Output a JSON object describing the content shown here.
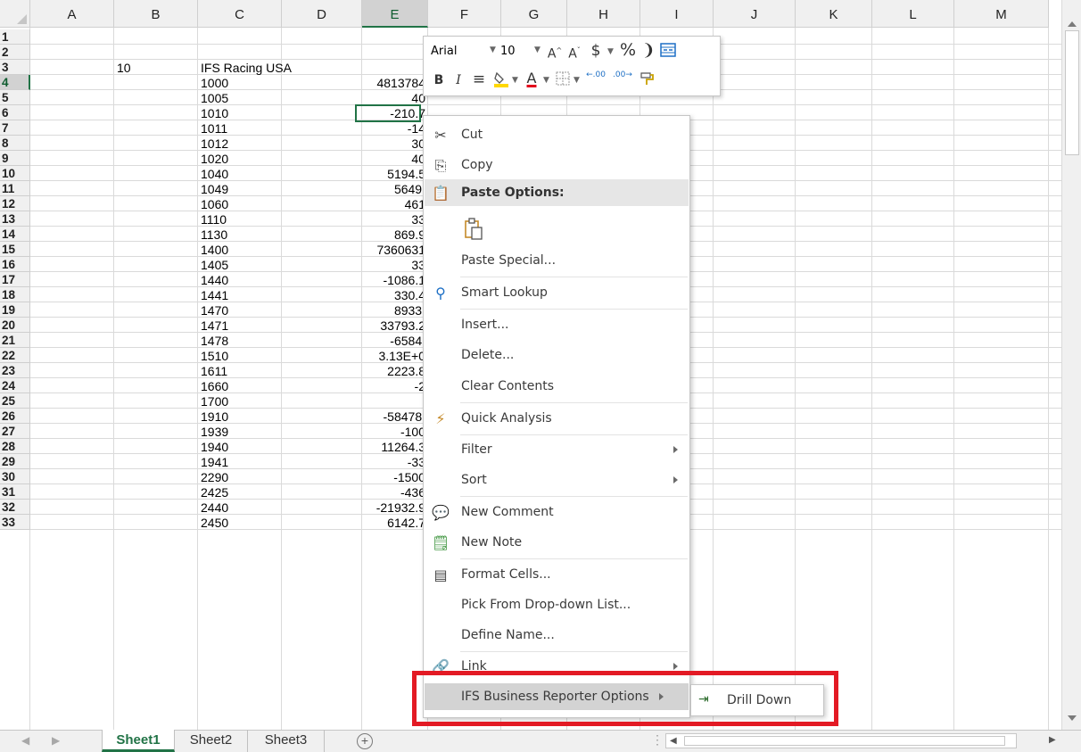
{
  "columns": [
    "A",
    "B",
    "C",
    "D",
    "E",
    "F",
    "G",
    "H",
    "I",
    "J",
    "K",
    "L",
    "M"
  ],
  "selected_column": "E",
  "row_numbers": [
    "1",
    "2",
    "3",
    "4",
    "5",
    "6",
    "7",
    "8",
    "9",
    "10",
    "11",
    "12",
    "13",
    "14",
    "15",
    "16",
    "17",
    "18",
    "19",
    "20",
    "21",
    "22",
    "23",
    "24",
    "25",
    "26",
    "27",
    "28",
    "29",
    "30",
    "31",
    "32",
    "33"
  ],
  "selected_row": "4",
  "cells": {
    "b3": "10",
    "c3": "IFS Racing USA",
    "col_c": [
      "1000",
      "1005",
      "1010",
      "1011",
      "1012",
      "1020",
      "1040",
      "1049",
      "1060",
      "1110",
      "1130",
      "1400",
      "1405",
      "1440",
      "1441",
      "1470",
      "1471",
      "1478",
      "1510",
      "1611",
      "1660",
      "1700",
      "1910",
      "1939",
      "1940",
      "1941",
      "2290",
      "2425",
      "2440",
      "2450"
    ],
    "col_e": [
      "4813784",
      "40",
      "-210.7",
      "-14",
      "30",
      "40",
      "5194.5",
      "5649.",
      "461",
      "33",
      "869.9",
      "7360631",
      "33",
      "-1086.1",
      "330.4",
      "8933.",
      "33793.2",
      "-6584.",
      "3.13E+0",
      "2223.8",
      "-2",
      "",
      "-58478.",
      "-100",
      "11264.3",
      "-33",
      "-1500",
      "-436",
      "-21932.9",
      "6142.7"
    ]
  },
  "mini_toolbar": {
    "font_name": "Arial",
    "font_size": "10",
    "grow_font": "A",
    "shrink_font": "A",
    "currency": "$",
    "percent": "%",
    "comma": "❩",
    "bold": "B",
    "italic": "I",
    "align": "≡",
    "font_color_letter": "A",
    "decimal_inc": ".00",
    "decimal_dec": ".00",
    "accent_fill": "#ffd800",
    "accent_font": "#e3001b"
  },
  "context_menu": {
    "cut": "Cut",
    "copy": "Copy",
    "paste_options": "Paste Options:",
    "paste_special": "Paste Special...",
    "smart_lookup": "Smart Lookup",
    "insert": "Insert...",
    "delete": "Delete...",
    "clear_contents": "Clear Contents",
    "quick_analysis": "Quick Analysis",
    "filter": "Filter",
    "sort": "Sort",
    "new_comment": "New Comment",
    "new_note": "New Note",
    "format_cells": "Format Cells...",
    "pick_from_list": "Pick From Drop-down List...",
    "define_name": "Define Name...",
    "link": "Link",
    "ifs_options": "IFS Business Reporter Options"
  },
  "submenu": {
    "drill_down": "Drill Down"
  },
  "sheet_tabs": [
    "Sheet1",
    "Sheet2",
    "Sheet3"
  ],
  "active_sheet": "Sheet1",
  "add_sheet": "+",
  "highlight_color": "#e31a24"
}
